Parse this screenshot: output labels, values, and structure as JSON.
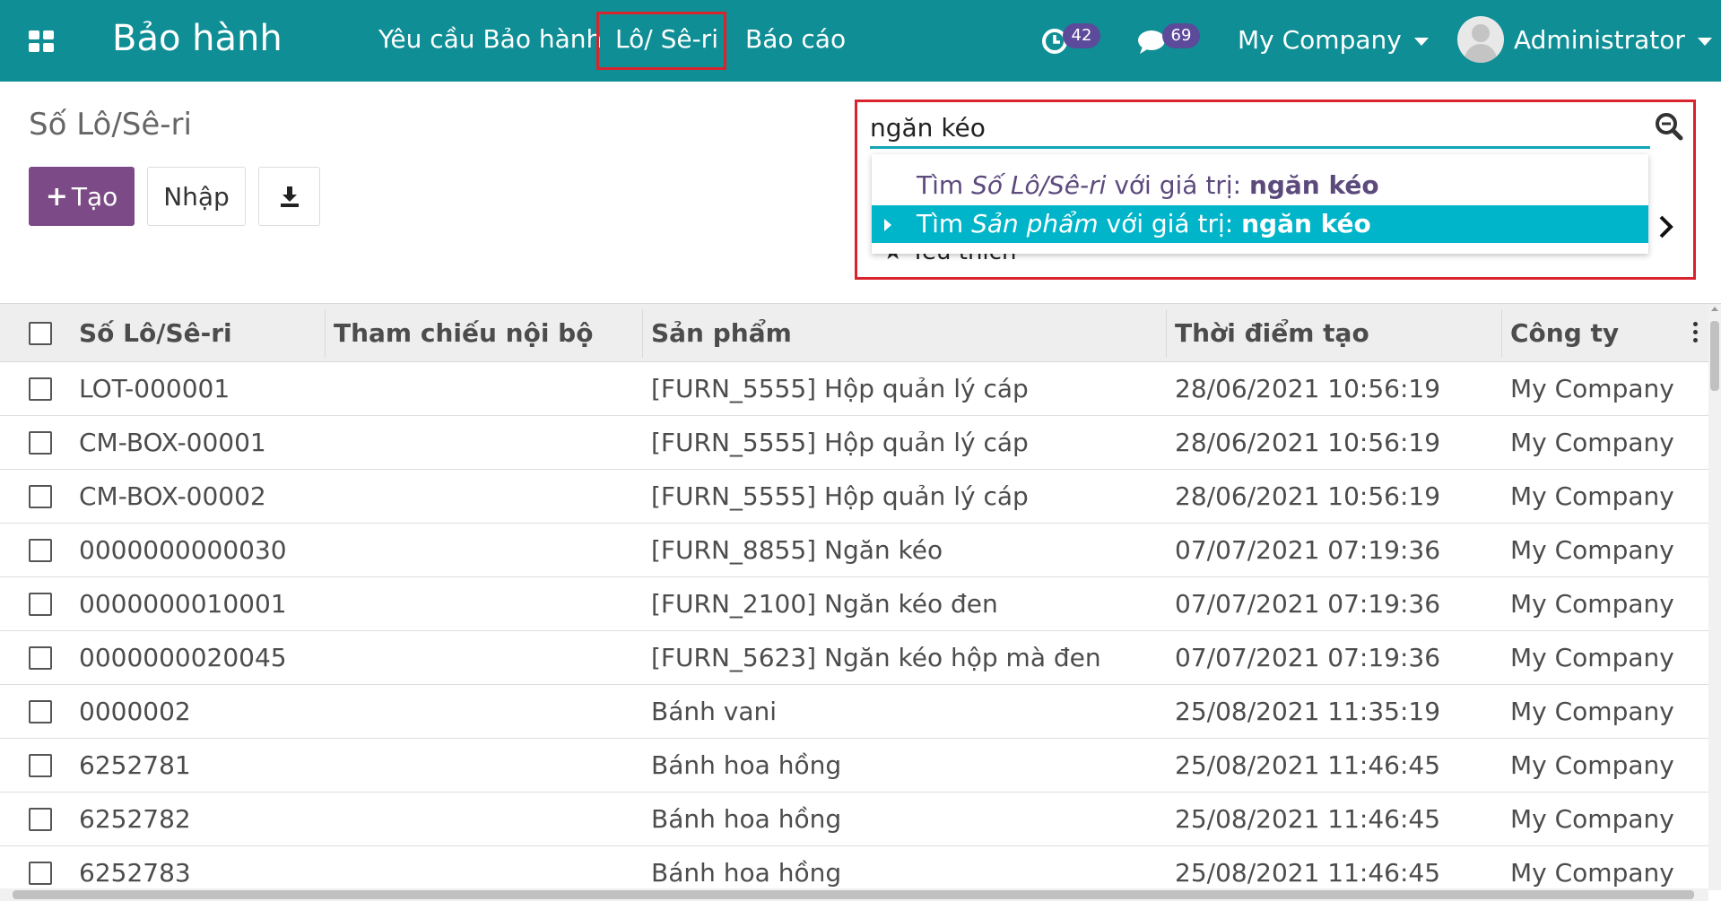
{
  "navbar": {
    "app_title": "Bảo hành",
    "menu": [
      "Yêu cầu Bảo hành",
      "Lô/ Sê-ri",
      "Báo cáo"
    ],
    "activity_count": "42",
    "message_count": "69",
    "company": "My Company",
    "user": "Administrator"
  },
  "control_panel": {
    "title": "Số Lô/Sê-ri",
    "create_label": "Tạo",
    "import_label": "Nhập"
  },
  "search": {
    "value": "ngăn kéo",
    "favorites_partial": "Yêu thích",
    "options": [
      {
        "prefix": "Tìm ",
        "field": "Số Lô/Sê-ri",
        "middle": " với giá trị: ",
        "value": "ngăn kéo"
      },
      {
        "prefix": "Tìm ",
        "field": "Sản phẩm",
        "middle": " với giá trị: ",
        "value": "ngăn kéo"
      }
    ]
  },
  "table": {
    "columns": [
      "Số Lô/Sê-ri",
      "Tham chiếu nội bộ",
      "Sản phẩm",
      "Thời điểm tạo",
      "Công ty"
    ],
    "rows": [
      [
        "LOT-000001",
        "",
        "[FURN_5555] Hộp quản lý cáp",
        "28/06/2021 10:56:19",
        "My Company"
      ],
      [
        "CM-BOX-00001",
        "",
        "[FURN_5555] Hộp quản lý cáp",
        "28/06/2021 10:56:19",
        "My Company"
      ],
      [
        "CM-BOX-00002",
        "",
        "[FURN_5555] Hộp quản lý cáp",
        "28/06/2021 10:56:19",
        "My Company"
      ],
      [
        "0000000000030",
        "",
        "[FURN_8855] Ngăn kéo",
        "07/07/2021 07:19:36",
        "My Company"
      ],
      [
        "0000000010001",
        "",
        "[FURN_2100] Ngăn kéo đen",
        "07/07/2021 07:19:36",
        "My Company"
      ],
      [
        "0000000020045",
        "",
        "[FURN_5623] Ngăn kéo hộp mà đen",
        "07/07/2021 07:19:36",
        "My Company"
      ],
      [
        "0000002",
        "",
        "Bánh vani",
        "25/08/2021 11:35:19",
        "My Company"
      ],
      [
        "6252781",
        "",
        "Bánh hoa hồng",
        "25/08/2021 11:46:45",
        "My Company"
      ],
      [
        "6252782",
        "",
        "Bánh hoa hồng",
        "25/08/2021 11:46:45",
        "My Company"
      ],
      [
        "6252783",
        "",
        "Bánh hoa hồng",
        "25/08/2021 11:46:45",
        "My Company"
      ]
    ]
  },
  "colors": {
    "navbar": "#0f8f95",
    "primary_button": "#7c4a86",
    "highlight_option": "#00b5c9",
    "annotation_box": "#d9232d",
    "badge": "#5c4a9b"
  }
}
